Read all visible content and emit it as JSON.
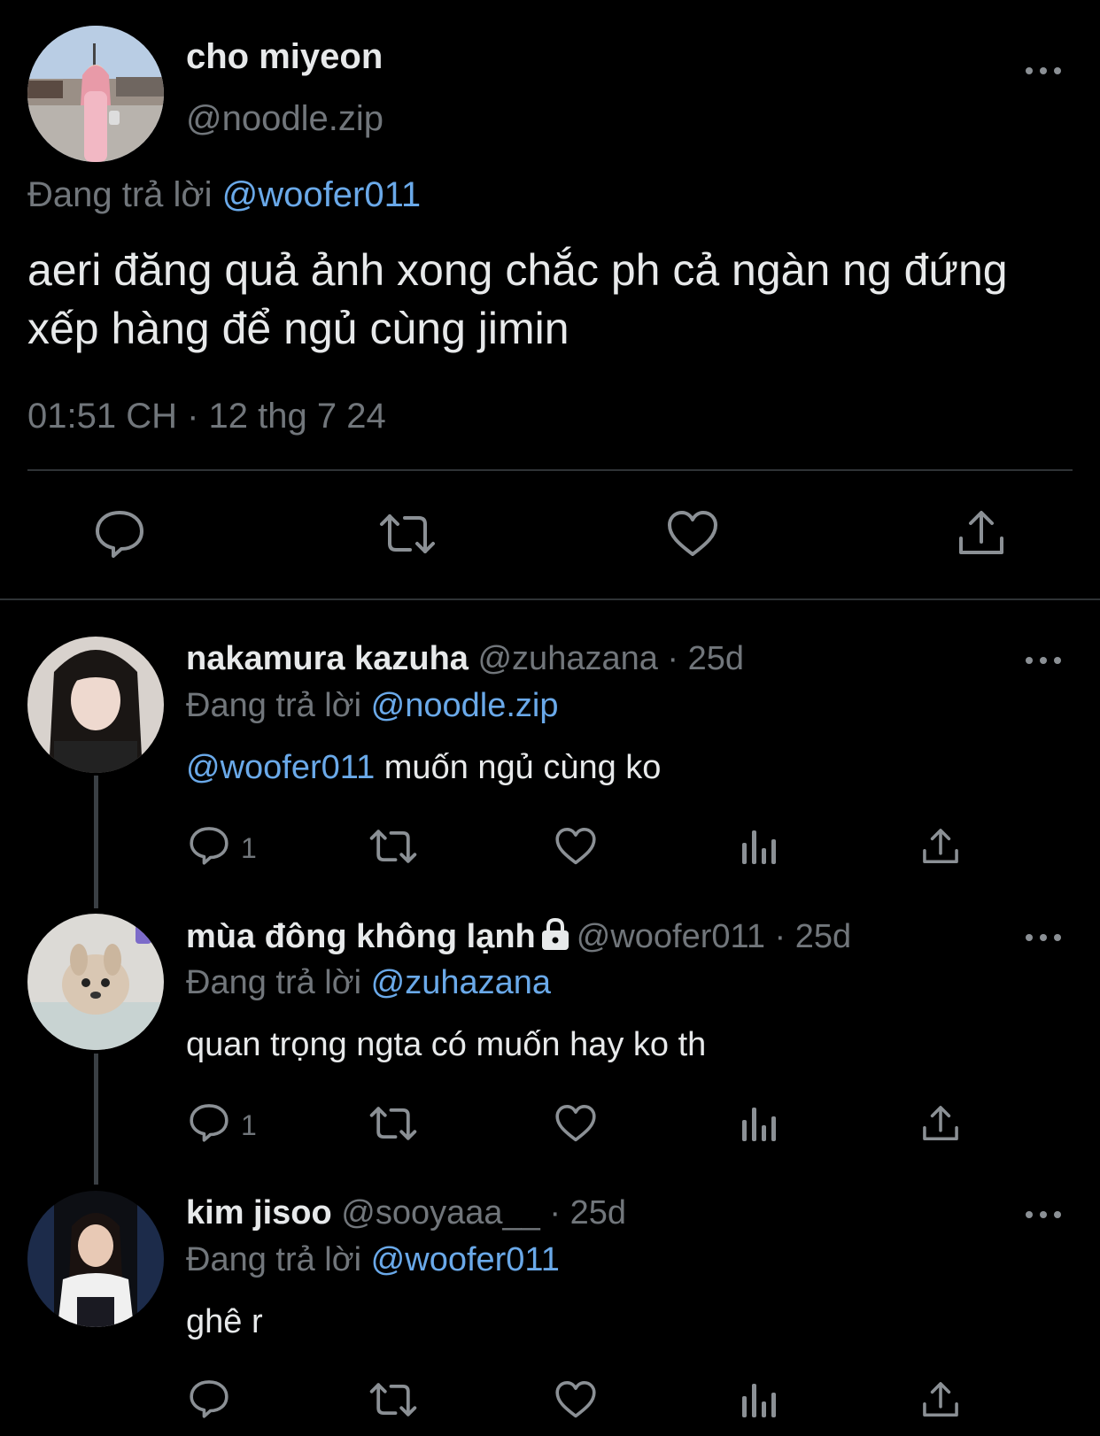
{
  "main_tweet": {
    "name": "cho miyeon",
    "handle": "@noodle.zip",
    "replying_prefix": "Đang trả lời ",
    "replying_to": "@woofer011",
    "text": "aeri đăng quả ảnh xong chắc ph cả ngàn ng đứng xếp hàng để ngủ cùng jimin",
    "timestamp": "01:51 CH · 12 thg 7 24",
    "actions": [
      "reply-icon",
      "retweet-icon",
      "like-icon",
      "share-icon"
    ]
  },
  "replies": [
    {
      "name": "nakamura kazuha",
      "handle": "@zuhazana",
      "time": " · 25d",
      "replying_prefix": "Đang trả lời ",
      "replying_to": "@noodle.zip",
      "mention": "@woofer011",
      "text": " muốn ngủ cùng ko",
      "reply_count": "1"
    },
    {
      "name": "mùa đông không lạnh",
      "handle": "@woofer011",
      "time": " · 25d",
      "protected": true,
      "replying_prefix": "Đang trả lời ",
      "replying_to": "@zuhazana",
      "text": "quan trọng ngta có muốn hay ko th",
      "reply_count": "1"
    },
    {
      "name": "kim jisoo",
      "handle": "@sooyaaa__",
      "time": " · 25d",
      "replying_prefix": "Đang trả lời ",
      "replying_to": "@woofer011",
      "text": "ghê r",
      "reply_count": ""
    }
  ],
  "colors": {
    "background": "#000000",
    "text": "#e7e9ea",
    "muted": "#71767b",
    "link": "#6aa9e9",
    "divider": "#2f3336"
  }
}
